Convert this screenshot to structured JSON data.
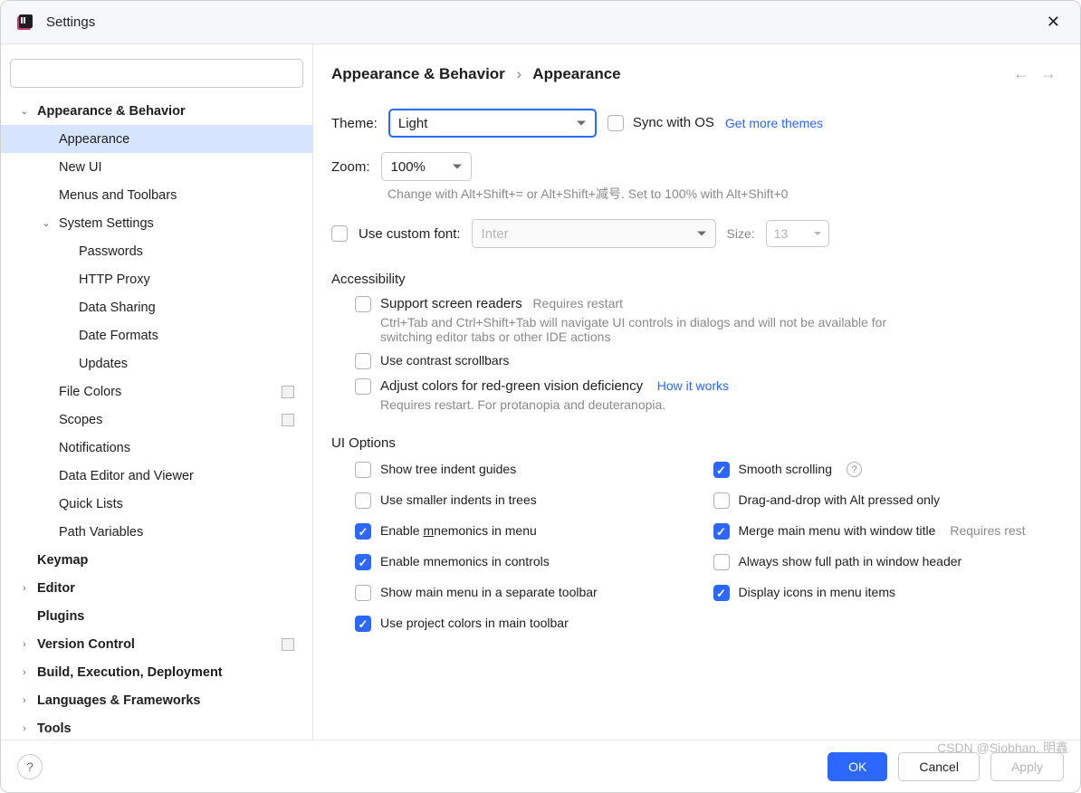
{
  "window": {
    "title": "Settings"
  },
  "search": {
    "value": ""
  },
  "sidebar": {
    "items": [
      {
        "label": "Appearance & Behavior",
        "level": 0,
        "bold": true,
        "expandable": true,
        "expanded": true
      },
      {
        "label": "Appearance",
        "level": 1,
        "selected": true
      },
      {
        "label": "New UI",
        "level": 1
      },
      {
        "label": "Menus and Toolbars",
        "level": 1
      },
      {
        "label": "System Settings",
        "level": 1,
        "expandable": true,
        "expanded": true
      },
      {
        "label": "Passwords",
        "level": 2
      },
      {
        "label": "HTTP Proxy",
        "level": 2
      },
      {
        "label": "Data Sharing",
        "level": 2
      },
      {
        "label": "Date Formats",
        "level": 2
      },
      {
        "label": "Updates",
        "level": 2
      },
      {
        "label": "File Colors",
        "level": 1,
        "badge": true
      },
      {
        "label": "Scopes",
        "level": 1,
        "badge": true
      },
      {
        "label": "Notifications",
        "level": 1
      },
      {
        "label": "Data Editor and Viewer",
        "level": 1
      },
      {
        "label": "Quick Lists",
        "level": 1
      },
      {
        "label": "Path Variables",
        "level": 1
      },
      {
        "label": "Keymap",
        "level": 0,
        "bold": true
      },
      {
        "label": "Editor",
        "level": 0,
        "bold": true,
        "expandable": true,
        "expanded": false
      },
      {
        "label": "Plugins",
        "level": 0,
        "bold": true
      },
      {
        "label": "Version Control",
        "level": 0,
        "bold": true,
        "expandable": true,
        "expanded": false,
        "badge": true
      },
      {
        "label": "Build, Execution, Deployment",
        "level": 0,
        "bold": true,
        "expandable": true,
        "expanded": false
      },
      {
        "label": "Languages & Frameworks",
        "level": 0,
        "bold": true,
        "expandable": true,
        "expanded": false
      },
      {
        "label": "Tools",
        "level": 0,
        "bold": true,
        "expandable": true,
        "expanded": false
      }
    ]
  },
  "breadcrumb": {
    "a": "Appearance & Behavior",
    "b": "Appearance"
  },
  "theme": {
    "label": "Theme:",
    "value": "Light",
    "sync_label": "Sync with OS",
    "sync_checked": false,
    "more_link": "Get more themes"
  },
  "zoom": {
    "label": "Zoom:",
    "value": "100%",
    "hint": "Change with Alt+Shift+= or Alt+Shift+减号. Set to 100% with Alt+Shift+0"
  },
  "font": {
    "use_label": "Use custom font:",
    "use_checked": false,
    "family": "Inter",
    "size_label": "Size:",
    "size_value": "13"
  },
  "accessibility": {
    "title": "Accessibility",
    "screen_readers": {
      "label": "Support screen readers",
      "checked": false,
      "restart": "Requires restart",
      "hint": "Ctrl+Tab and Ctrl+Shift+Tab will navigate UI controls in dialogs and will not be available for switching editor tabs or other IDE actions"
    },
    "contrast": {
      "label": "Use contrast scrollbars",
      "checked": false
    },
    "colorblind": {
      "label": "Adjust colors for red-green vision deficiency",
      "checked": false,
      "how_link": "How it works",
      "hint": "Requires restart. For protanopia and deuteranopia."
    }
  },
  "ui_options": {
    "title": "UI Options",
    "left": [
      {
        "label": "Show tree indent guides",
        "checked": false
      },
      {
        "label": "Use smaller indents in trees",
        "checked": false
      },
      {
        "label": "Enable mnemonics in menu",
        "checked": true,
        "underline_char": "m"
      },
      {
        "label": "Enable mnemonics in controls",
        "checked": true
      },
      {
        "label": "Show main menu in a separate toolbar",
        "checked": false
      },
      {
        "label": "Use project colors in main toolbar",
        "checked": true
      }
    ],
    "right": [
      {
        "label": "Smooth scrolling",
        "checked": true,
        "help": true
      },
      {
        "label": "Drag-and-drop with Alt pressed only",
        "checked": false
      },
      {
        "label": "Merge main menu with window title",
        "checked": true,
        "trail": "Requires rest"
      },
      {
        "label": "Always show full path in window header",
        "checked": false
      },
      {
        "label": "Display icons in menu items",
        "checked": true
      }
    ]
  },
  "footer": {
    "ok": "OK",
    "cancel": "Cancel",
    "apply": "Apply"
  },
  "watermark": "CSDN @Siobhan. 明鑫"
}
